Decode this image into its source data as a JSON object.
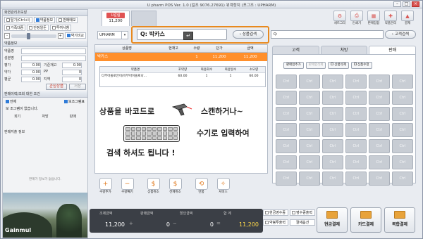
{
  "title": "U pharm POS Ver. 1.0 (일조 9076.27691) 위계정치 (포그조 : UPHARM)",
  "left_panel": {
    "group1_title": "화면관리조보장",
    "cb_row1": [
      "탈기(Ctrl+I)",
      "약품정보",
      "판매메모"
    ],
    "cb_row2": [
      "가족대중",
      "안정일돈",
      "투여사항"
    ],
    "cb_extra": "약기비교",
    "group2_title": "약품정보",
    "fields": [
      "약품명",
      "성분명",
      "보험코드",
      "약가"
    ],
    "nums": [
      [
        "0.00",
        "0.00"
      ],
      [
        "0.00",
        "0"
      ],
      [
        "0.00",
        "0"
      ]
    ],
    "num_labels": [
      [
        "평가",
        "기준재고"
      ],
      [
        "약가",
        "PP"
      ],
      [
        "평균",
        "지역"
      ]
    ],
    "buttons": [
      "관심상품",
      "저장"
    ],
    "group3_title": "판매이력/조회 대한 조건",
    "cb_all": "전체",
    "cb_rx": "보조그램표",
    "no_data": "보 조그램이 없습니다.",
    "cols": [
      "회기",
      "처방",
      "판매"
    ],
    "group4_title": "판매지출 정보",
    "bottom_note": "판매가 정보가 없습니다.",
    "brand": "Gainmul"
  },
  "customer_tabs": {
    "active_name": "U갈림",
    "active_amount": "11,200"
  },
  "toolbar": [
    "세트그리",
    "인쇄기",
    "판매집합",
    "약품관리",
    "결재"
  ],
  "search": {
    "combo": "UPHARM",
    "query": "박카스",
    "product_btn": "상품검색",
    "customer_btn": "고객검색"
  },
  "grid": {
    "headers": [
      "상품명",
      "현재고",
      "수량",
      "단가",
      "금액"
    ],
    "row": {
      "name": "박카스",
      "stock": "",
      "qty": "1",
      "price": "11,200",
      "amount": "11,200"
    },
    "sub_headers": [
      "약품명",
      "포약량",
      "복용회수",
      "복용일수",
      "소모량"
    ],
    "sub_row": {
      "name": "디부아올로안이(이부아이올로나...",
      "a": "60.00",
      "b": "1",
      "c": "1",
      "d": "60.00"
    },
    "msg1": "상품을 바코드로",
    "msg1b": "스캔하거나~",
    "msg2": "수기로 입력하여",
    "msg3": "검색 하셔도 됩니다 !"
  },
  "actions": [
    "수량추가",
    "수량빼기",
    "상품취소",
    "전체취소",
    "반품",
    "서비스"
  ],
  "totals": {
    "labels": [
      "조제금액",
      "판매금액",
      "할인금액",
      "합 계"
    ],
    "values": [
      "11,200",
      "0",
      "0",
      "11,200"
    ]
  },
  "checks": [
    "현금영수증",
    "영수증출력",
    "약봉투출력",
    "결재옵션"
  ],
  "pay_buttons": [
    "현금결제",
    "카드결제",
    "복합결제"
  ],
  "right": {
    "tabs": [
      "고객",
      "처방",
      "판매"
    ],
    "top_btns": [
      "판매합추가",
      "판매합삭제",
      "상품삭제",
      "상품수정"
    ],
    "cell_label": "Ctrl"
  }
}
